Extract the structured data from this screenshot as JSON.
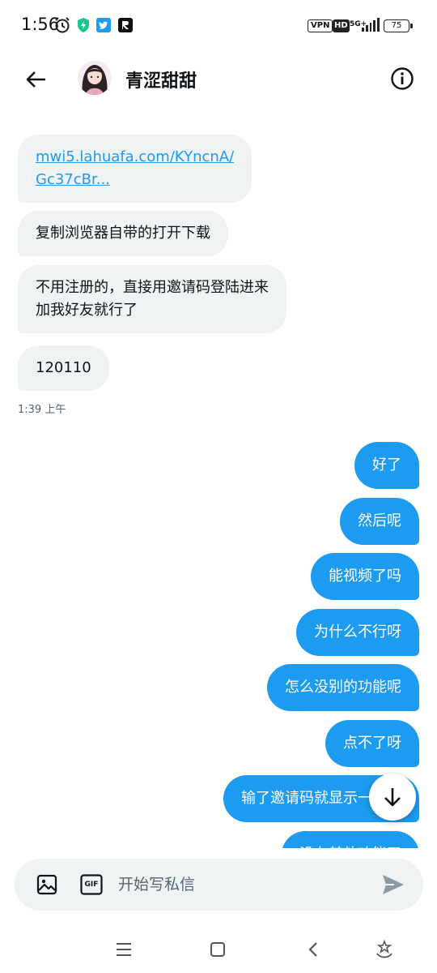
{
  "status_bar": {
    "time": "1:56",
    "vpn": "VPN",
    "hd": "HD",
    "network": "5G+",
    "battery": "75",
    "icons": [
      "alarm-icon",
      "shield-icon",
      "twitter-icon",
      "app-icon",
      "signal-icon",
      "battery-icon"
    ]
  },
  "header": {
    "title": "青涩甜甜",
    "back_icon": "arrow-left-icon",
    "info_icon": "info-circle-icon"
  },
  "messages": {
    "incoming": [
      {
        "line1": "mwi5.lahuafa.com/KYncnA/",
        "line2": "Gc37cBr..."
      },
      {
        "text": "复制浏览器自带的打开下载"
      },
      {
        "line1": "不用注册的，直接用邀请码登陆进来",
        "line2": "加我好友就行了"
      },
      {
        "text": "120110"
      }
    ],
    "timestamp": "1:39 上午",
    "outgoing": [
      {
        "text": "好了"
      },
      {
        "text": "然后呢"
      },
      {
        "text": "能视频了吗"
      },
      {
        "text": "为什么不行呀"
      },
      {
        "text": "怎么没别的功能呢"
      },
      {
        "text": "点不了呀"
      },
      {
        "text": "输了邀请码就显示一个其"
      },
      {
        "text": "没有其他功能了"
      }
    ]
  },
  "composer": {
    "placeholder": "开始写私信",
    "gif_label": "GIF"
  },
  "colors": {
    "accent": "#1d9bf0",
    "incoming_bubble": "#eff3f4",
    "text": "#0f1419",
    "secondary_text": "#536471"
  }
}
